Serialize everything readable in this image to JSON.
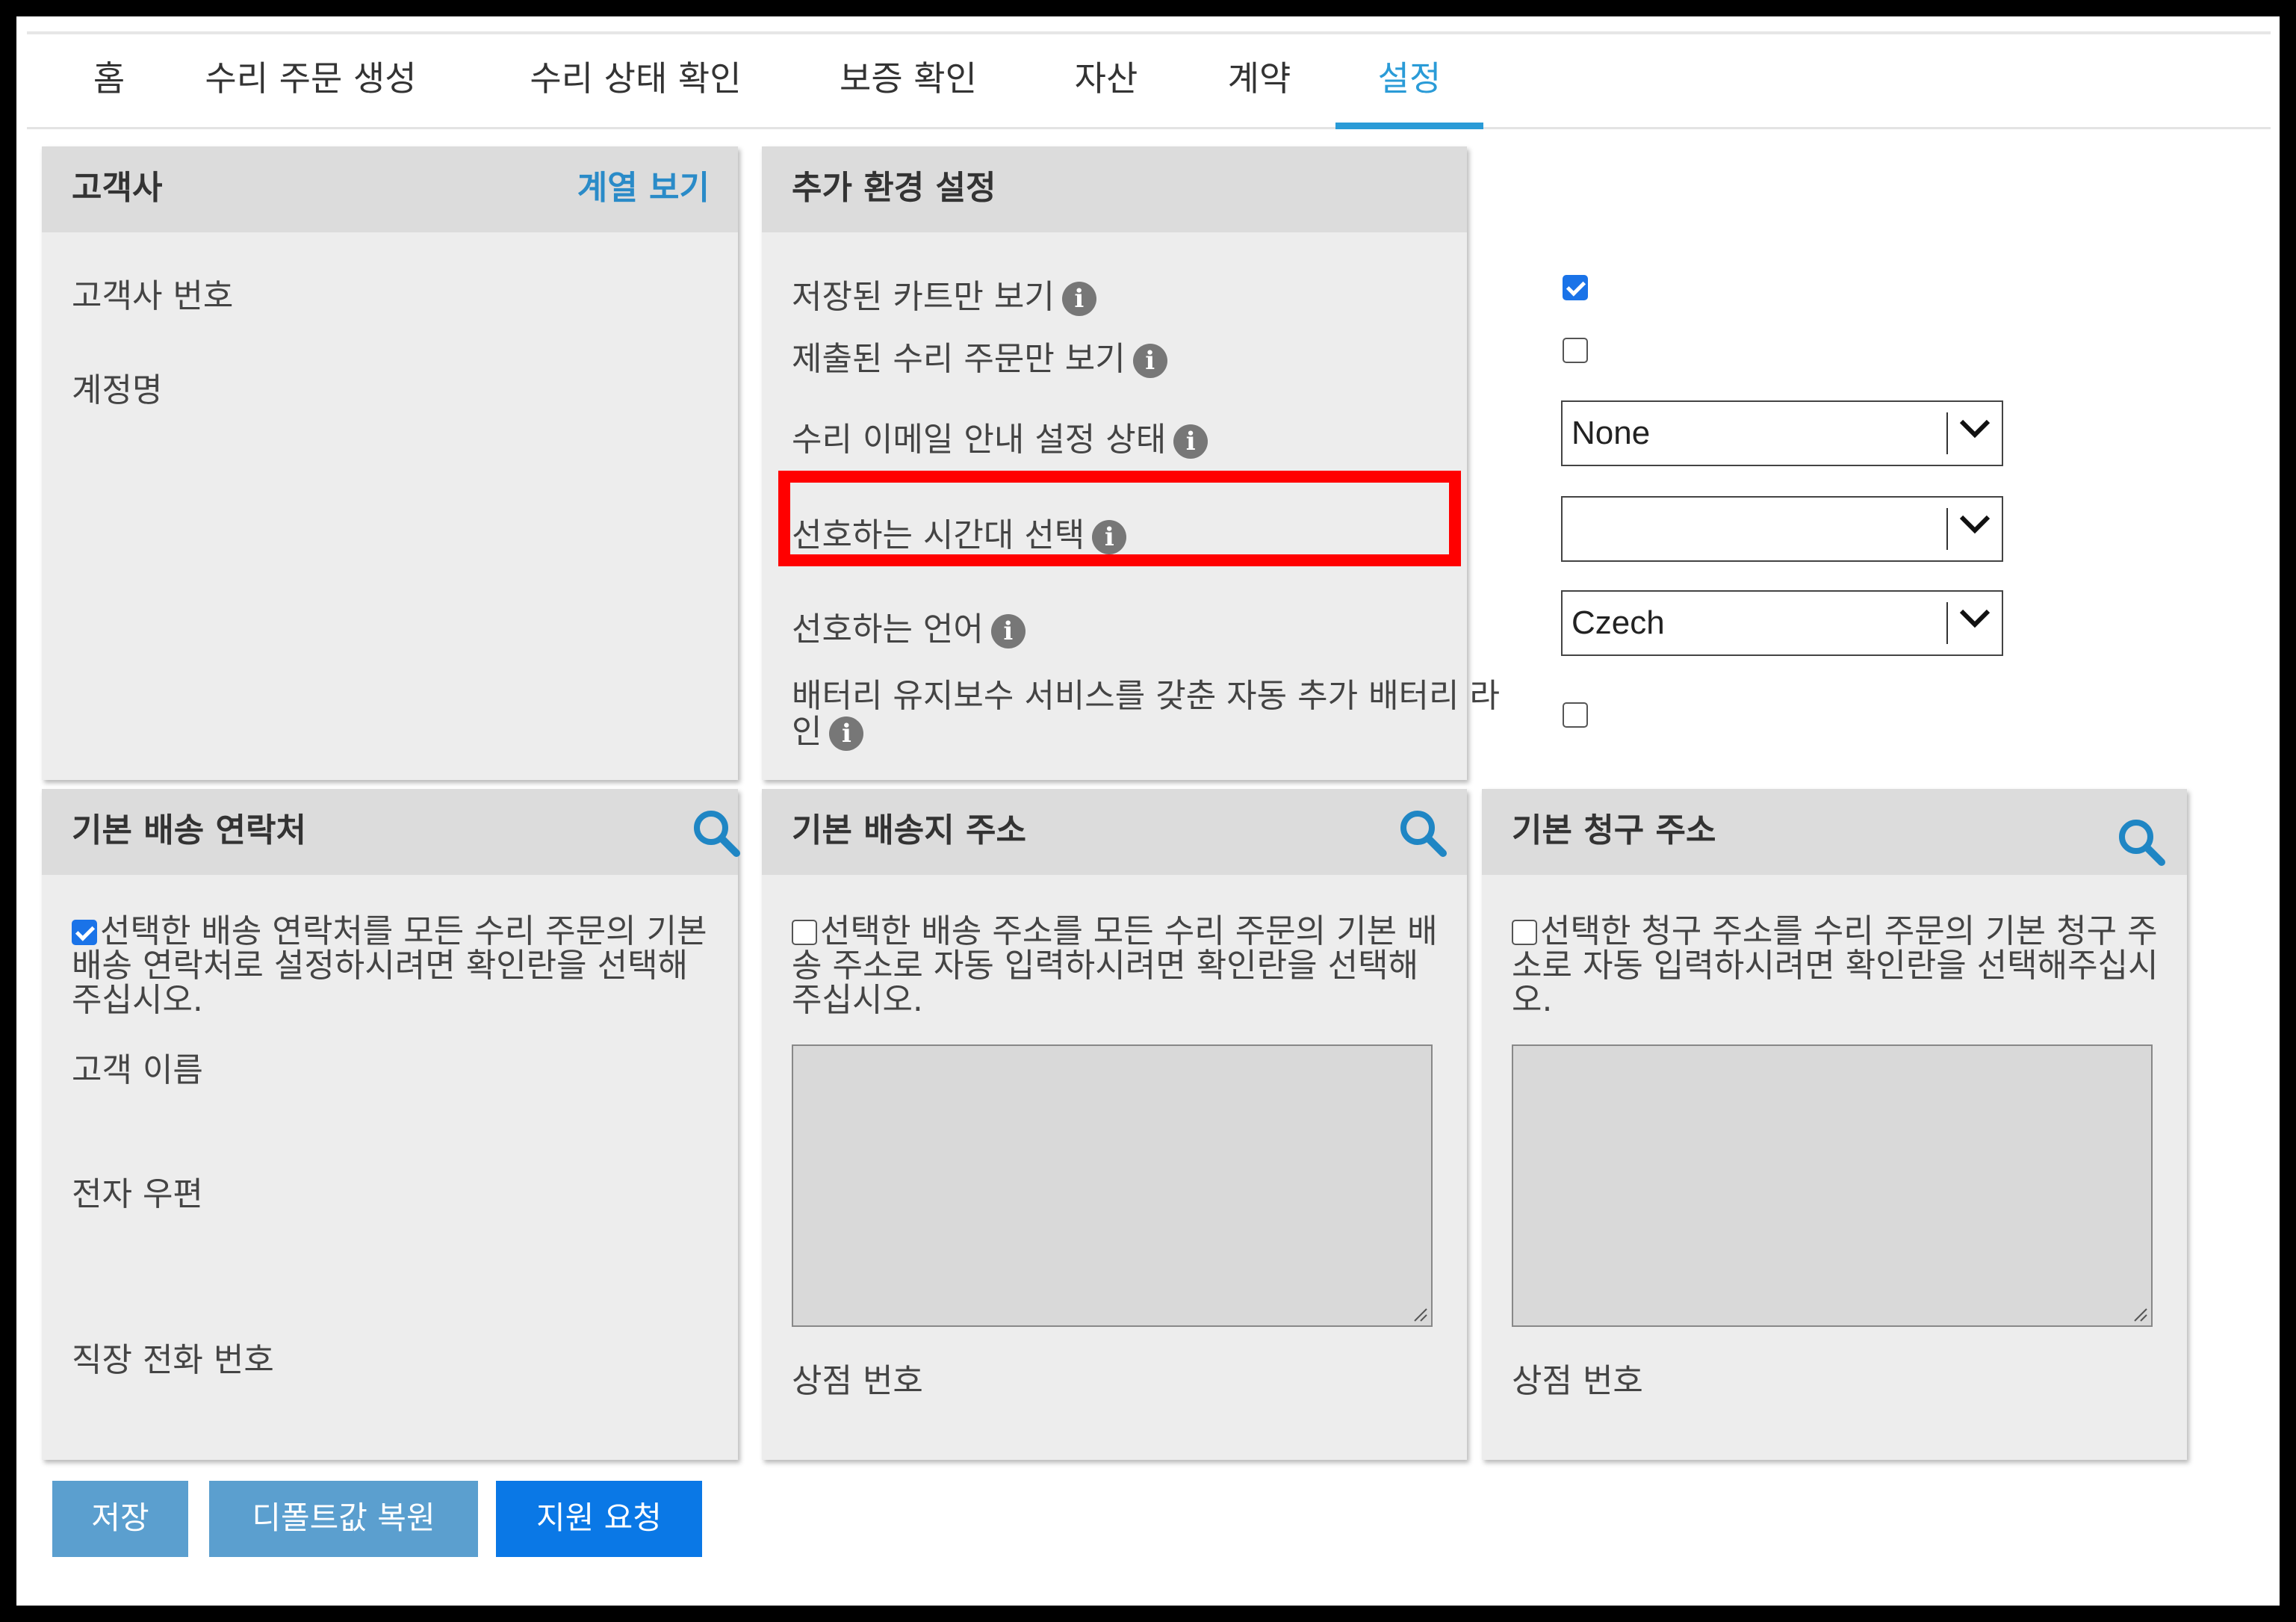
{
  "nav": {
    "tabs": [
      {
        "label": "홈"
      },
      {
        "label": "수리 주문 생성"
      },
      {
        "label": "수리 상태 확인"
      },
      {
        "label": "보증 확인"
      },
      {
        "label": "자산"
      },
      {
        "label": "계약"
      },
      {
        "label": "설정",
        "active": true
      }
    ]
  },
  "customer": {
    "title": "고객사",
    "link": "계열 보기",
    "fields": [
      "고객사 번호",
      "계정명"
    ]
  },
  "prefs": {
    "title": "추가 환경 설정",
    "saved_cart_only": {
      "label": "저장된 카트만 보기",
      "checked": true
    },
    "submitted_orders_only": {
      "label": "제출된 수리 주문만 보기",
      "checked": false
    },
    "email_notify": {
      "label": "수리 이메일 안내 설정 상태",
      "value": "None"
    },
    "timezone": {
      "label": "선호하는 시간대 선택",
      "value": ""
    },
    "language": {
      "label": "선호하는 언어",
      "value": "Czech"
    },
    "battery": {
      "label_line1": "배터리 유지보수 서비스를 갖춘 자동 추가 배터리 라",
      "label_line2": "인",
      "checked": false
    }
  },
  "shipping_contact": {
    "title": "기본 배송 연락처",
    "checkbox_checked": true,
    "hint": "선택한 배송 연락처를 모든 수리 주문의 기본 배송 연락처로 설정하시려면 확인란을 선택해주십시오.",
    "fields": [
      "고객 이름",
      "전자 우편",
      "직장 전화 번호"
    ]
  },
  "shipping_address": {
    "title": "기본 배송지 주소",
    "checkbox_checked": false,
    "hint": "선택한 배송 주소를 모든 수리 주문의 기본 배송 주소로 자동 입력하시려면 확인란을 선택해주십시오.",
    "store_label": "상점 번호"
  },
  "billing_address": {
    "title": "기본 청구 주소",
    "checkbox_checked": false,
    "hint": "선택한 청구 주소를 수리 주문의 기본 청구 주소로 자동 입력하시려면 확인란을 선택해주십시오.",
    "store_label": "상점 번호"
  },
  "buttons": {
    "save": "저장",
    "restore": "디폴트값 복원",
    "support": "지원 요청"
  },
  "colors": {
    "accent": "#2a9bd7",
    "save_button": "#5b9fcf",
    "support_button": "#0a78e6",
    "highlight": "#ff0000"
  }
}
